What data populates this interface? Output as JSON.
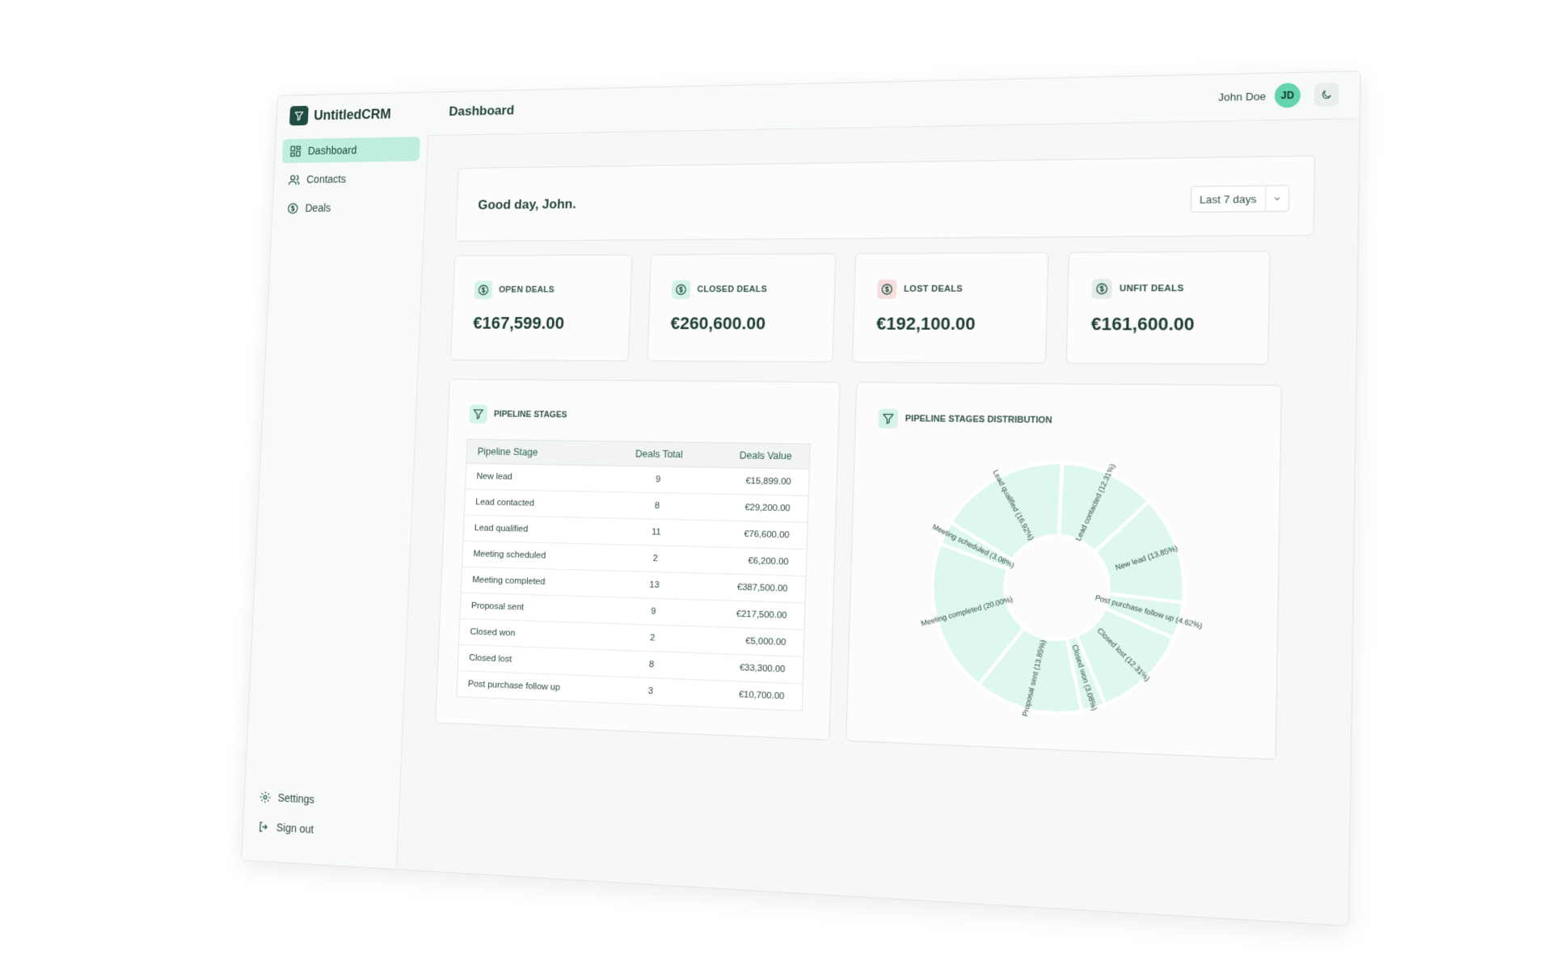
{
  "app": {
    "logo_text": "UntitledCRM"
  },
  "sidebar": {
    "items": [
      {
        "label": "Dashboard",
        "active": true
      },
      {
        "label": "Contacts"
      },
      {
        "label": "Deals"
      }
    ],
    "bottom": [
      {
        "label": "Settings"
      },
      {
        "label": "Sign out"
      }
    ]
  },
  "header": {
    "title": "Dashboard",
    "user_name": "John Doe",
    "user_initials": "JD"
  },
  "greeting": {
    "text": "Good day, John.",
    "range_select": "Last 7 days"
  },
  "stats": [
    {
      "label": "OPEN DEALS",
      "value": "€167,599.00"
    },
    {
      "label": "CLOSED DEALS",
      "value": "€260,600.00"
    },
    {
      "label": "LOST DEALS",
      "value": "€192,100.00"
    },
    {
      "label": "UNFIT DEALS",
      "value": "€161,600.00"
    }
  ],
  "pipeline": {
    "title": "PIPELINE STAGES",
    "columns": [
      "Pipeline Stage",
      "Deals Total",
      "Deals Value"
    ],
    "rows": [
      [
        "New lead",
        "9",
        "€15,899.00"
      ],
      [
        "Lead contacted",
        "8",
        "€29,200.00"
      ],
      [
        "Lead qualified",
        "11",
        "€76,600.00"
      ],
      [
        "Meeting scheduled",
        "2",
        "€6,200.00"
      ],
      [
        "Meeting completed",
        "13",
        "€387,500.00"
      ],
      [
        "Proposal sent",
        "9",
        "€217,500.00"
      ],
      [
        "Closed won",
        "2",
        "€5,000.00"
      ],
      [
        "Closed lost",
        "8",
        "€33,300.00"
      ],
      [
        "Post purchase follow up",
        "3",
        "€10,700.00"
      ]
    ]
  },
  "distribution": {
    "title": "PIPELINE STAGES DISTRIBUTION"
  },
  "chart_data": {
    "type": "pie",
    "slices": [
      {
        "label": "Lead contacted (12.31%)",
        "value": 12.31
      },
      {
        "label": "New lead (13.85%)",
        "value": 13.85
      },
      {
        "label": "Post purchase follow up (4.62%)",
        "value": 4.62
      },
      {
        "label": "Closed lost (12.31%)",
        "value": 12.31
      },
      {
        "label": "Closed won (3.08%)",
        "value": 3.08
      },
      {
        "label": "Proposal sent (13.85%)",
        "value": 13.85
      },
      {
        "label": "Meeting completed (20.00%)",
        "value": 20.0
      },
      {
        "label": "Meeting scheduled (3.08%)",
        "value": 3.08
      },
      {
        "label": "Lead qualified (16.92%)",
        "value": 16.92
      }
    ],
    "colors": {
      "fill": "#dff8ee",
      "stroke": "#ffffff",
      "text": "#2b4a42"
    }
  }
}
